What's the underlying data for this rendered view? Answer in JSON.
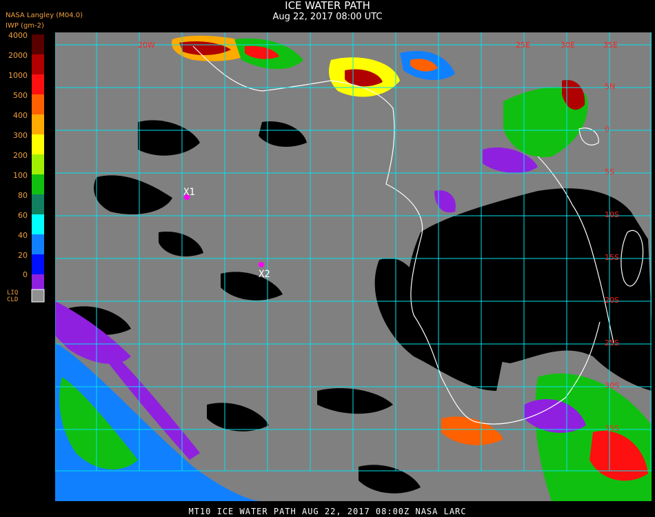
{
  "header": {
    "title": "ICE WATER PATH",
    "subtitle": "Aug 22, 2017 08:00 UTC",
    "source": "NASA Langley (M04.0)",
    "units": "IWP (gm-2)"
  },
  "legend": {
    "levels": [
      {
        "label": "4000",
        "color": "#5a0000"
      },
      {
        "label": "2000",
        "color": "#b00000"
      },
      {
        "label": "1000",
        "color": "#ff1010"
      },
      {
        "label": "500",
        "color": "#ff6000"
      },
      {
        "label": "400",
        "color": "#ffaa00"
      },
      {
        "label": "300",
        "color": "#ffff00"
      },
      {
        "label": "200",
        "color": "#a0f000"
      },
      {
        "label": "100",
        "color": "#10c010"
      },
      {
        "label": "80",
        "color": "#108060"
      },
      {
        "label": "60",
        "color": "#00ffff"
      },
      {
        "label": "40",
        "color": "#1080ff"
      },
      {
        "label": "20",
        "color": "#0010ff"
      },
      {
        "label": "0",
        "color": "#9020e0"
      }
    ],
    "liquid_cloud": {
      "line1": "LIQ",
      "line2": "CLD",
      "color": "#909090"
    }
  },
  "map": {
    "gray_color": "#808080",
    "grid_color": "#00e5ee",
    "coast_color": "#ffffff",
    "label_color": "#ff2020",
    "lon_labels": [
      "20W",
      "25E",
      "30E",
      "35E"
    ],
    "lat_labels": [
      "5N",
      "0",
      "5S",
      "10S",
      "15S",
      "20S",
      "25S",
      "30S",
      "35S"
    ],
    "markers": [
      {
        "label": "X1",
        "color": "#ff00ff"
      },
      {
        "label": "X2",
        "color": "#ff00ff"
      }
    ]
  },
  "footer": {
    "text": "MT10   ICE WATER PATH   AUG 22, 2017 08:00Z   NASA LARC"
  }
}
